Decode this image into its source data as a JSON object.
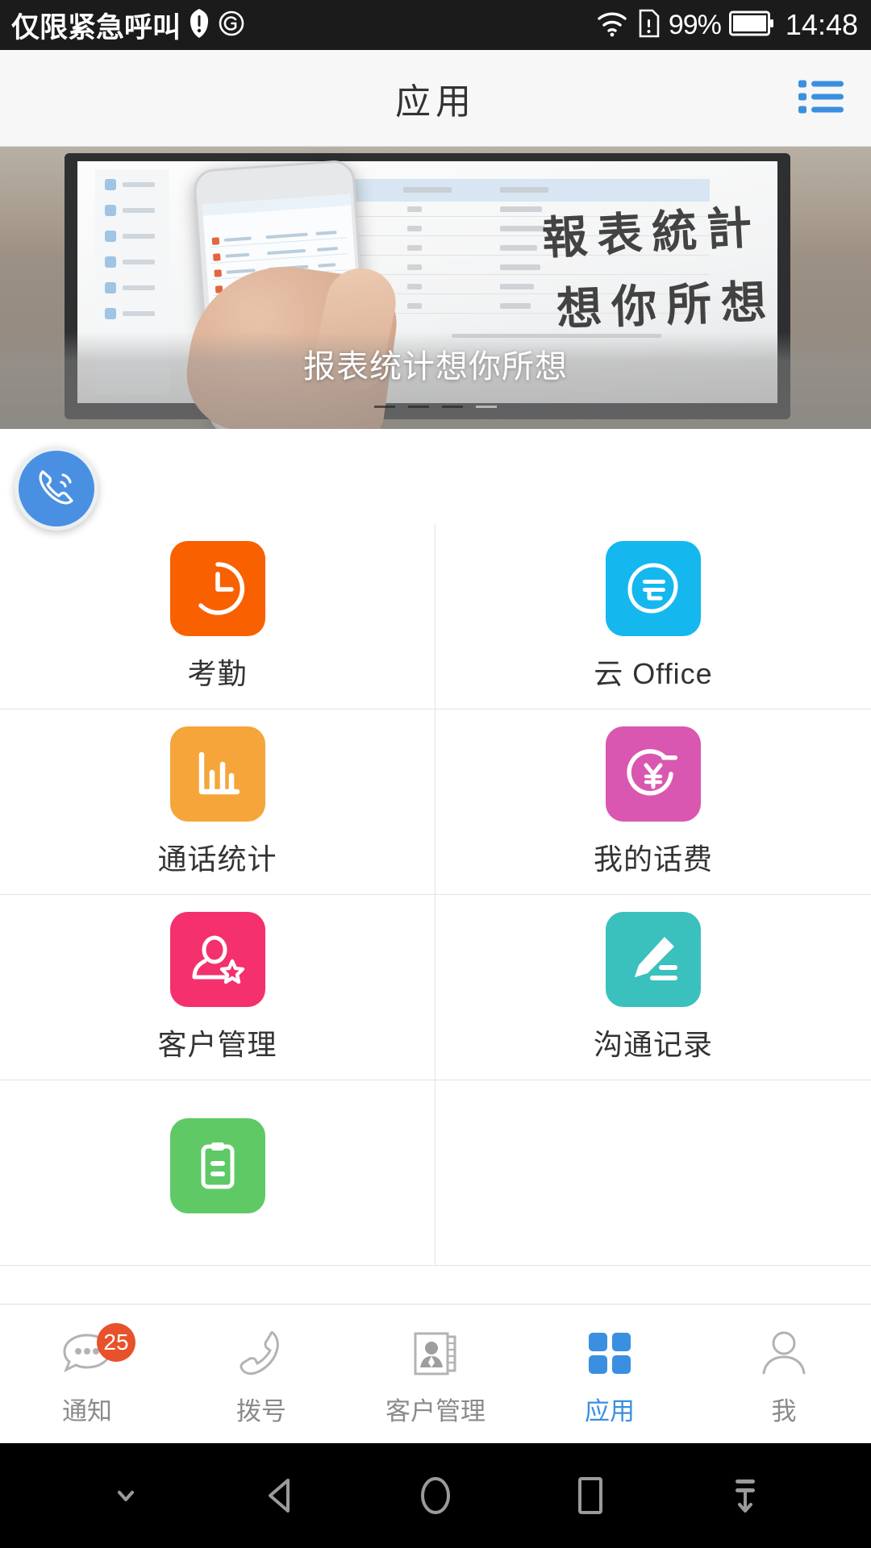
{
  "status_bar": {
    "carrier": "仅限紧急呼叫",
    "warning_icon": "warning-badge-icon",
    "network_icon": "g-network-icon",
    "wifi_icon": "wifi-icon",
    "sim_icon": "sim-card-alert-icon",
    "battery_percent": "99%",
    "battery_icon": "battery-full-icon",
    "time": "14:48"
  },
  "header": {
    "title": "应用",
    "menu_icon": "list-menu-icon"
  },
  "banner": {
    "caption": "报表统计想你所想",
    "calligraphy_line1": "報表統計",
    "calligraphy_line2": "想你所想",
    "dots": 4,
    "active_dot": 1,
    "fab_icon": "phone-call-icon",
    "fab_color": "#4a90e2"
  },
  "apps": [
    {
      "label": "考勤",
      "icon": "clock-icon",
      "color": "#f96000"
    },
    {
      "label": "云 Office",
      "icon": "cloud-yun-icon",
      "color": "#15b7ef"
    },
    {
      "label": "通话统计",
      "icon": "bar-chart-icon",
      "color": "#f5a53a"
    },
    {
      "label": "我的话费",
      "icon": "yuan-coin-icon",
      "color": "#d957b0"
    },
    {
      "label": "客户管理",
      "icon": "person-star-icon",
      "color": "#f4306d"
    },
    {
      "label": "沟通记录",
      "icon": "pencil-note-icon",
      "color": "#3ac0bd"
    },
    {
      "label": "",
      "icon": "clipboard-icon",
      "color": "#5fc966"
    },
    {
      "label": "",
      "icon": "",
      "color": ""
    }
  ],
  "tabs": [
    {
      "label": "通知",
      "icon": "chat-bubble-icon",
      "badge": "25",
      "active": false
    },
    {
      "label": "拨号",
      "icon": "phone-handset-icon",
      "badge": "",
      "active": false
    },
    {
      "label": "客户管理",
      "icon": "contact-card-icon",
      "badge": "",
      "active": false
    },
    {
      "label": "应用",
      "icon": "grid-squares-icon",
      "badge": "",
      "active": true
    },
    {
      "label": "我",
      "icon": "person-icon",
      "badge": "",
      "active": false
    }
  ],
  "nav_bar": {
    "hide_icon": "chevron-down-icon",
    "back_icon": "back-triangle-icon",
    "home_icon": "home-circle-icon",
    "recents_icon": "recents-square-icon",
    "pulldown_icon": "notification-pulldown-icon"
  },
  "colors": {
    "accent": "#3b8fe0",
    "badge": "#e8522a",
    "tab_inactive": "#8a8a8a"
  }
}
